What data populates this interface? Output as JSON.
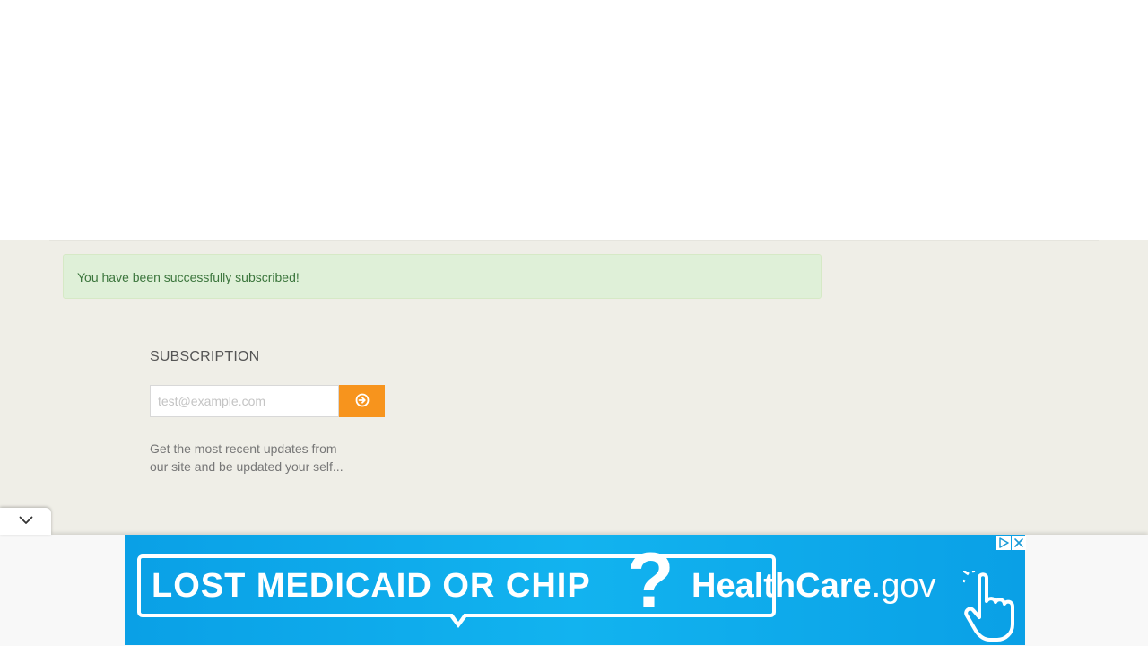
{
  "alert": {
    "message": "You have been successfully subscribed!",
    "colors": {
      "background": "#dff0d8",
      "border": "#d6e9c6",
      "text": "#3c763d"
    }
  },
  "subscription": {
    "title": "SUBSCRIPTION",
    "email_placeholder": "test@example.com",
    "email_value": "",
    "submit_icon": "arrow-circle-right-icon",
    "description": "Get the most recent updates from our site and be updated your self...",
    "accent_color": "#f7941d"
  },
  "collapse_tab": {
    "icon": "chevron-down-icon"
  },
  "ad": {
    "headline": "LOST MEDICAID OR CHIP",
    "question_mark": "?",
    "brand_main": "HealthCare",
    "brand_suffix": ".gov",
    "hand_icon": "pointing-hand-icon",
    "adchoices_icon": "adchoices-icon",
    "close_icon": "close-icon",
    "background_color": "#10adec"
  }
}
